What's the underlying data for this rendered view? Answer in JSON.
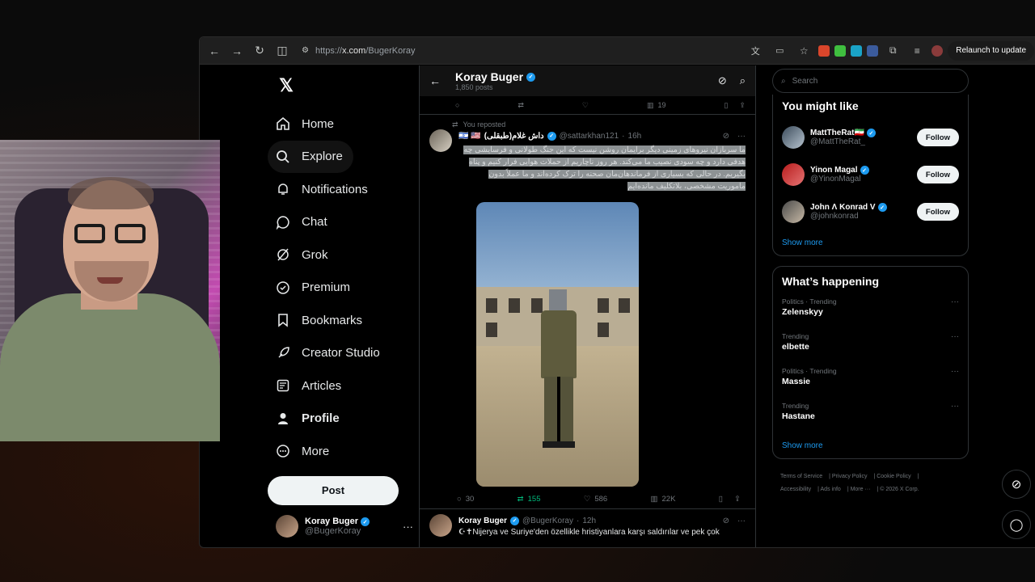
{
  "browser": {
    "url_prefix": "https://",
    "url_domain": "x.com",
    "url_path": "/BugerKoray",
    "relaunch_label": "Relaunch to update"
  },
  "nav": {
    "items": [
      {
        "label": "Home",
        "icon": "home-icon"
      },
      {
        "label": "Explore",
        "icon": "search-icon"
      },
      {
        "label": "Notifications",
        "icon": "bell-icon"
      },
      {
        "label": "Chat",
        "icon": "chat-icon"
      },
      {
        "label": "Grok",
        "icon": "grok-icon"
      },
      {
        "label": "Premium",
        "icon": "premium-icon"
      },
      {
        "label": "Bookmarks",
        "icon": "bookmark-icon"
      },
      {
        "label": "Creator Studio",
        "icon": "rocket-icon"
      },
      {
        "label": "Articles",
        "icon": "article-icon"
      },
      {
        "label": "Profile",
        "icon": "person-icon"
      },
      {
        "label": "More",
        "icon": "more-circle-icon"
      }
    ],
    "post_label": "Post",
    "account": {
      "name": "Koray Buger",
      "handle": "@BugerKoray"
    }
  },
  "profile_header": {
    "name": "Koray Buger",
    "posts": "1,850 posts"
  },
  "prev_actions": {
    "views": "19"
  },
  "tweet": {
    "reposted": "You reposted",
    "author": "داش غلام(طبقلی)",
    "flags": "🇮🇱 🇺🇸",
    "handle": "@sattarkhan121",
    "time": "16h",
    "text_lines": [
      "ما سربازان نیروهای زمینی دیگر برایمان روشن نیست که این جنگ طولانی و فرسایشی چه",
      "هدفی دارد و چه سودی نصیب ما می‌کند. هر روز ناچاریم از حملات هوایی فرار کنیم و پناه",
      "بگیریم. در حالی که بسیاری از فرماندهان‌مان صحنه را ترک کرده‌اند و ما عملاً بدون",
      "ماموریت مشخصی، بلاتکلیف مانده‌ایم"
    ],
    "replies": "30",
    "reposts": "155",
    "likes": "586",
    "views": "22K"
  },
  "tweet2": {
    "author": "Koray Buger",
    "handle": "@BugerKoray",
    "time": "12h",
    "text": "Nijerya ve Suriye'den özellikle hristiyanlara karşı saldırılar ve pek çok"
  },
  "search": {
    "placeholder": "Search"
  },
  "might_like": {
    "title": "You might like",
    "people": [
      {
        "name": "MattTheRat🇮🇷",
        "handle": "@MattTheRat_",
        "follow": "Follow"
      },
      {
        "name": "Yinon Magal",
        "handle": "@YinonMagal",
        "follow": "Follow"
      },
      {
        "name": "John Λ Konrad V",
        "handle": "@johnkonrad",
        "follow": "Follow"
      }
    ],
    "show_more": "Show more"
  },
  "happening": {
    "title": "What’s happening",
    "trends": [
      {
        "context": "Politics · Trending",
        "topic": "Zelenskyy"
      },
      {
        "context": "Trending",
        "topic": "elbette"
      },
      {
        "context": "Politics · Trending",
        "topic": "Massie"
      },
      {
        "context": "Trending",
        "topic": "Hastane"
      }
    ],
    "show_more": "Show more"
  },
  "footer": {
    "links": [
      "Terms of Service",
      "Privacy Policy",
      "Cookie Policy",
      "Accessibility",
      "Ads info",
      "More ···"
    ],
    "copyright": "© 2026 X Corp."
  },
  "colors": {
    "accent": "#1d9bf0",
    "repost_green": "#00ba7c",
    "background": "#000000"
  }
}
